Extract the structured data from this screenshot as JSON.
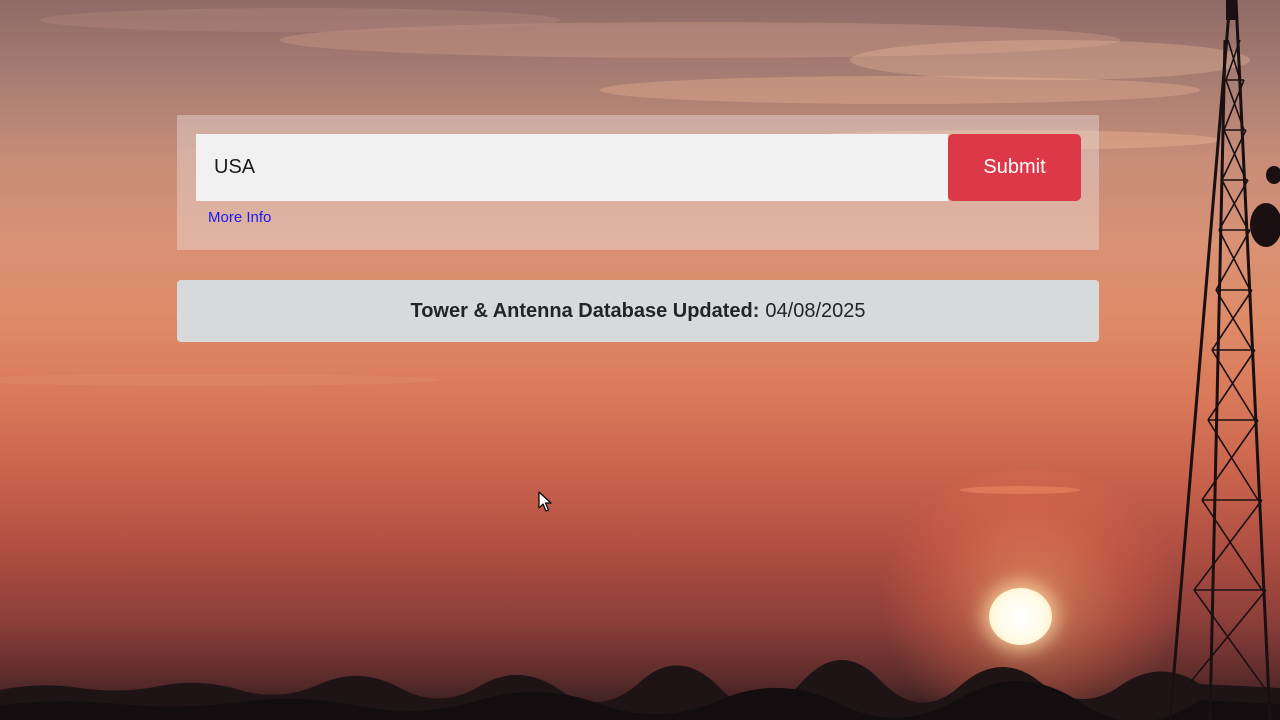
{
  "search": {
    "value": "USA",
    "submit_label": "Submit",
    "more_info_label": "More Info"
  },
  "update_banner": {
    "label": "Tower & Antenna Database Updated:",
    "date": "04/08/2025"
  },
  "colors": {
    "submit_bg": "#dc3848",
    "link": "#1a1af0",
    "banner_bg": "#d8d9db",
    "input_bg": "#f1f1f1"
  },
  "icons": {
    "pointer": "mouse-pointer-icon"
  }
}
